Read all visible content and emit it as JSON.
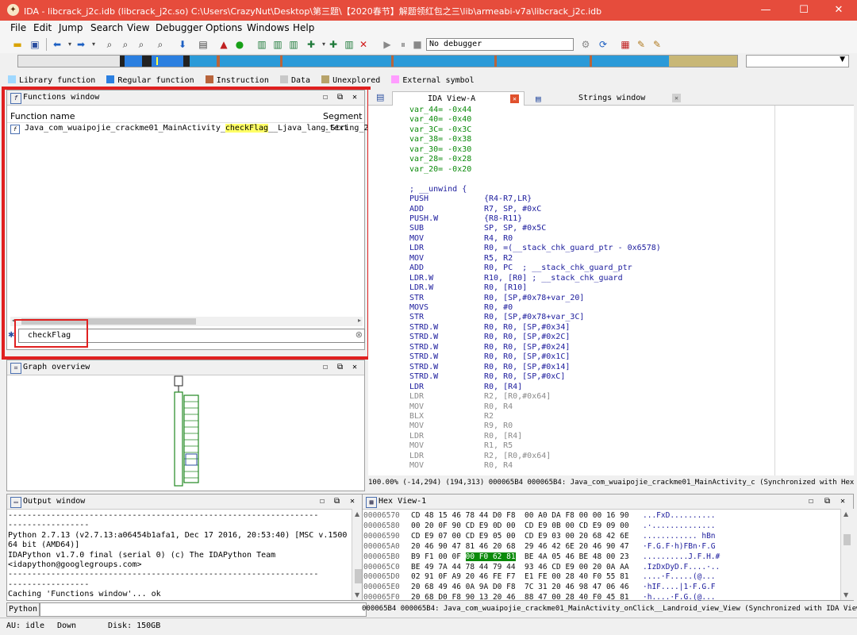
{
  "window": {
    "title": "IDA - libcrack_j2c.idb (libcrack_j2c.so) C:\\Users\\CrazyNut\\Desktop\\第三题\\【2020春节】解题领红包之三\\lib\\armeabi-v7a\\libcrack_j2c.idb",
    "minimize": "—",
    "maximize": "☐",
    "close": "✕"
  },
  "menu": [
    "File",
    "Edit",
    "Jump",
    "Search",
    "View",
    "Debugger",
    "Options",
    "Windows",
    "Help"
  ],
  "toolbar": {
    "debugger": "No debugger"
  },
  "legend": [
    {
      "label": "Library function",
      "color": "#9fd8ff"
    },
    {
      "label": "Regular function",
      "color": "#2b7fe0"
    },
    {
      "label": "Instruction",
      "color": "#b8643b"
    },
    {
      "label": "Data",
      "color": "#c8c8c8"
    },
    {
      "label": "Unexplored",
      "color": "#b7a36a"
    },
    {
      "label": "External symbol",
      "color": "#ff9dff"
    }
  ],
  "functions_window": {
    "title": "Functions window",
    "col_name": "Function name",
    "col_segment": "Segment",
    "row_prefix": "Java_com_wuaipojie_crackme01_MainActivity_",
    "row_highlight": "checkFlag",
    "row_suffix": "__Ljava_lang_String_2",
    "row_segment": ".text",
    "filter": "checkFlag"
  },
  "ida_view": {
    "tab1": "IDA View-A",
    "tab2": "Strings window",
    "vars": [
      "var_44= -0x44",
      "var_40= -0x40",
      "var_3C= -0x3C",
      "var_38= -0x38",
      "var_30= -0x30",
      "var_28= -0x28",
      "var_20= -0x20"
    ],
    "unwind": "; __unwind {",
    "instructions": [
      [
        "PUSH",
        "{R4-R7,LR}"
      ],
      [
        "ADD",
        "R7, SP, #0xC"
      ],
      [
        "PUSH.W",
        "{R8-R11}"
      ],
      [
        "SUB",
        "SP, SP, #0x5C"
      ],
      [
        "MOV",
        "R4, R0"
      ],
      [
        "LDR",
        "R0, =(__stack_chk_guard_ptr - 0x6578)"
      ],
      [
        "MOV",
        "R5, R2"
      ],
      [
        "ADD",
        "R0, PC  ; __stack_chk_guard_ptr"
      ],
      [
        "LDR.W",
        "R10, [R0] ; __stack_chk_guard"
      ],
      [
        "LDR.W",
        "R0, [R10]"
      ],
      [
        "STR",
        "R0, [SP,#0x78+var_20]"
      ],
      [
        "MOVS",
        "R0, #0"
      ],
      [
        "STR",
        "R0, [SP,#0x78+var_3C]"
      ],
      [
        "STRD.W",
        "R0, R0, [SP,#0x34]"
      ],
      [
        "STRD.W",
        "R0, R0, [SP,#0x2C]"
      ],
      [
        "STRD.W",
        "R0, R0, [SP,#0x24]"
      ],
      [
        "STRD.W",
        "R0, R0, [SP,#0x1C]"
      ],
      [
        "STRD.W",
        "R0, R0, [SP,#0x14]"
      ],
      [
        "STRD.W",
        "R0, R0, [SP,#0xC]"
      ],
      [
        "LDR",
        "R0, [R4]"
      ],
      [
        "LDR",
        "R2, [R0,#0x64]"
      ],
      [
        "MOV",
        "R0, R4"
      ],
      [
        "BLX",
        "R2"
      ],
      [
        "MOV",
        "R9, R0"
      ],
      [
        "LDR",
        "R0, [R4]"
      ],
      [
        "MOV",
        "R1, R5"
      ],
      [
        "LDR",
        "R2, [R0,#0x64]"
      ],
      [
        "MOV",
        "R0, R4"
      ]
    ],
    "status": "100.00% (-14,294) (194,313) 000065B4 000065B4: Java_com_wuaipojie_crackme01_MainActivity_c (Synchronized with Hex View-1)"
  },
  "graph_overview": {
    "title": "Graph overview"
  },
  "output_window": {
    "title": "Output window",
    "lines": [
      "-----------------------------------------------------------------",
      "-----------------",
      "Python 2.7.13 (v2.7.13:a06454b1afa1, Dec 17 2016, 20:53:40) [MSC v.1500",
      "64 bit (AMD64)]",
      "IDAPython v1.7.0 final (serial 0) (c) The IDAPython Team",
      "<idapython@googlegroups.com>",
      "-----------------------------------------------------------------",
      "-----------------",
      "Caching 'Functions window'... ok"
    ],
    "python_label": "Python"
  },
  "hex_view": {
    "title": "Hex View-1",
    "rows": [
      {
        "addr": "00006570",
        "bytes": "CD 48 15 46 78 44 D0 F8  00 A0 DA F8 00 00 16 90",
        "ascii": "...FxD.........."
      },
      {
        "addr": "00006580",
        "bytes": "00 20 0F 90 CD E9 0D 00  CD E9 0B 00 CD E9 09 00",
        "ascii": ".·.............."
      },
      {
        "addr": "00006590",
        "bytes": "CD E9 07 00 CD E9 05 00  CD E9 03 00 20 68 42 6E",
        "ascii": "............ hBn"
      },
      {
        "addr": "000065A0",
        "bytes": "20 46 90 47 81 46 20 68  29 46 42 6E 20 46 90 47",
        "ascii": "·F.G.F·h)FBn·F.G"
      },
      {
        "addr": "000065B0",
        "bytes_pre": "B9 F1 00 0F ",
        "bytes_hl": "00 F0 62 81",
        "bytes_post": "  BE 4A 05 46 BE 48 00 23",
        "ascii": "..........J.F.H.#"
      },
      {
        "addr": "000065C0",
        "bytes": "BE 49 7A 44 78 44 79 44  93 46 CD E9 00 20 0A AA",
        "ascii": ".IzDxDyD.F....·.."
      },
      {
        "addr": "000065D0",
        "bytes": "02 91 0F A9 20 46 FE F7  E1 FE 00 28 40 F0 55 81",
        "ascii": "....·F.....(@..."
      },
      {
        "addr": "000065E0",
        "bytes": "20 68 49 46 0A 9A D0 F8  7C 31 20 46 98 47 06 46",
        "ascii": "·hIF....|1·F.G.F"
      },
      {
        "addr": "000065F0",
        "bytes": "20 68 D0 F8 90 13 20 46  88 47 00 28 40 F0 45 81",
        "ascii": "·h....·F.G.(@..."
      }
    ],
    "status": "000065B4 000065B4: Java_com_wuaipojie_crackme01_MainActivity_onClick__Landroid_view_View (Synchronized with IDA View-A)"
  },
  "statusbar": {
    "au": "AU:",
    "au_state": "idle",
    "dir": "Down",
    "disk": "Disk: 150GB"
  }
}
